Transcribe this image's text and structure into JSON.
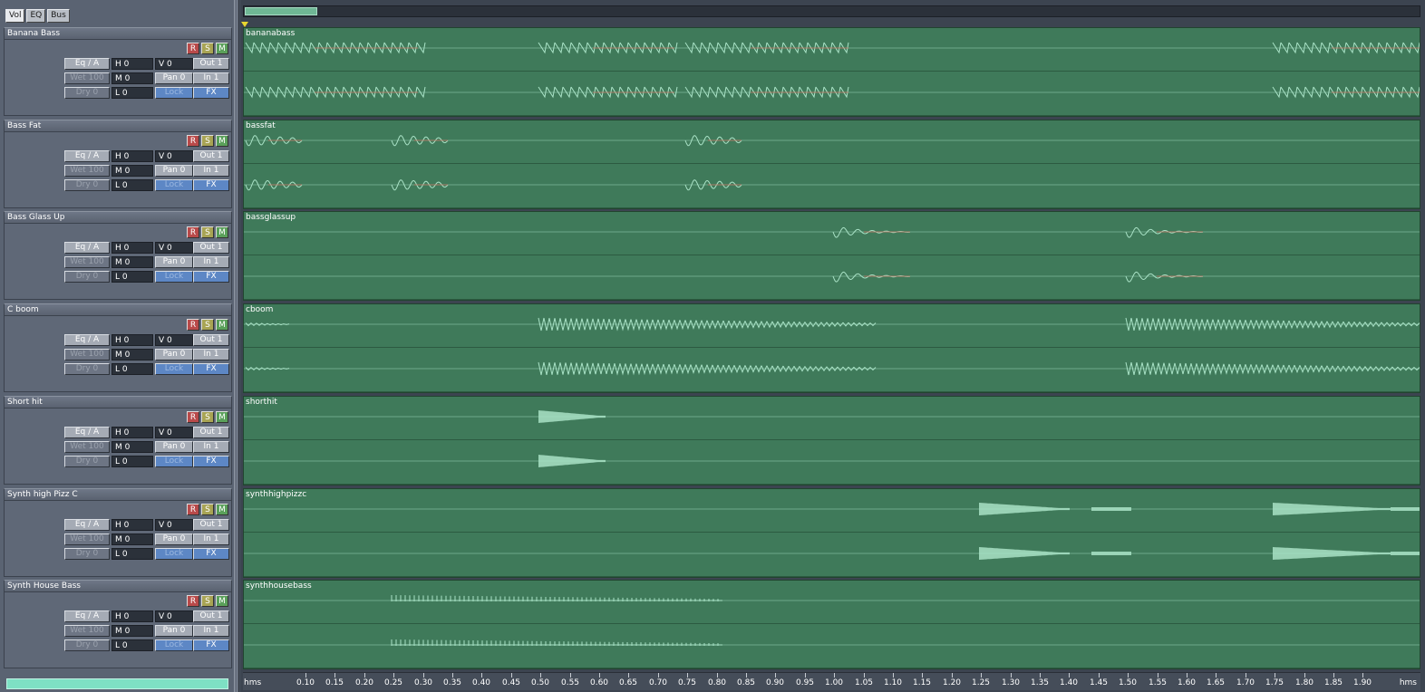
{
  "mode_tabs": [
    "Vol",
    "EQ",
    "Bus"
  ],
  "strip_labels": {
    "record": "R",
    "solo": "S",
    "mute": "M",
    "eq": "Eq / A",
    "high": "H  0",
    "volume": "V 0",
    "out": "Out 1",
    "wet": "Wet 100",
    "mid": "M  0",
    "pan": "Pan 0",
    "in": "In 1",
    "dry": "Dry 0",
    "low": "L  0",
    "lock": "Lock",
    "fx": "FX"
  },
  "tracks": [
    {
      "name": "Banana Bass",
      "clip": "bananabass"
    },
    {
      "name": "Bass Fat",
      "clip": "bassfat"
    },
    {
      "name": "Bass Glass Up",
      "clip": "bassglassup"
    },
    {
      "name": "C boom",
      "clip": "cboom"
    },
    {
      "name": "Short hit",
      "clip": "shorthit"
    },
    {
      "name": "Synth high Pizz C",
      "clip": "synthhighpizzc"
    },
    {
      "name": "Synth House Bass",
      "clip": "synthhousebass"
    }
  ],
  "ruler": {
    "unit": "hms",
    "ticks": [
      "0.10",
      "0.15",
      "0.20",
      "0.25",
      "0.30",
      "0.35",
      "0.40",
      "0.45",
      "0.50",
      "0.55",
      "0.60",
      "0.65",
      "0.70",
      "0.75",
      "0.80",
      "0.85",
      "0.90",
      "0.95",
      "1.00",
      "1.05",
      "1.10",
      "1.15",
      "1.20",
      "1.25",
      "1.30",
      "1.35",
      "1.40",
      "1.45",
      "1.50",
      "1.55",
      "1.60",
      "1.65",
      "1.70",
      "1.75",
      "1.80",
      "1.85",
      "1.90"
    ]
  },
  "colors": {
    "lane_bg": "#3f7a5a",
    "wave": "#a9e2c6",
    "wave_accent": "#c96a5a",
    "meter": "#7ee0c4",
    "playhead": "#e8d630"
  }
}
